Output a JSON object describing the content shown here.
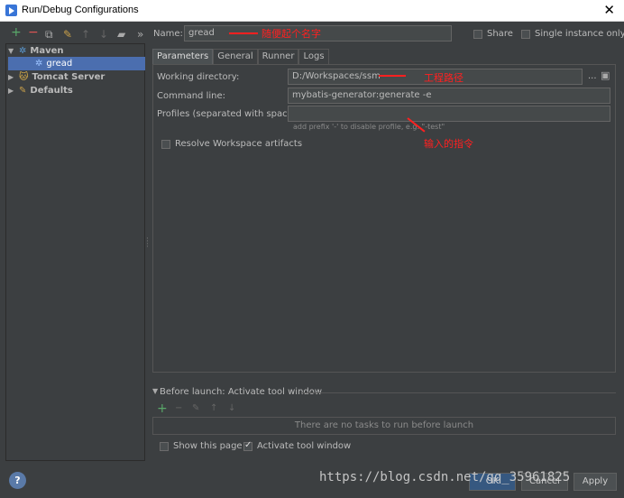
{
  "window": {
    "title": "Run/Debug Configurations"
  },
  "toolbar": {
    "add": "+",
    "remove": "−",
    "more": "»"
  },
  "tree": [
    {
      "label": "Maven",
      "expanded": true
    },
    {
      "label": "gread",
      "selected": true
    },
    {
      "label": "Tomcat Server",
      "expanded": false
    },
    {
      "label": "Defaults",
      "expanded": false
    }
  ],
  "name_row": {
    "label": "Name:",
    "value": "gread",
    "share": "Share",
    "single_instance": "Single instance only"
  },
  "tabs": [
    "Parameters",
    "General",
    "Runner",
    "Logs"
  ],
  "params": {
    "working_dir_label": "Working directory:",
    "working_dir_value": "D:/Workspaces/ssm",
    "browse_dots": "...",
    "command_label": "Command line:",
    "command_value": "mybatis-generator:generate -e",
    "profiles_label": "Profiles (separated with space):",
    "profiles_hint": "add prefix '-' to disable profile, e.g. \"-test\"",
    "resolve_label": "Resolve Workspace artifacts"
  },
  "annotations": {
    "name": "随便起个名字",
    "path": "工程路径",
    "command": "输入的指令"
  },
  "before_launch": {
    "title": "Before launch: Activate tool window",
    "empty_text": "There are no tasks to run before launch",
    "show_page": "Show this page",
    "activate": "Activate tool window"
  },
  "buttons": {
    "ok": "OK",
    "cancel": "Cancel",
    "apply": "Apply",
    "help": "?"
  },
  "watermark": "https://blog.csdn.net/qq_35961825",
  "colors": {
    "selection": "#4b6eaf",
    "annotation": "#ff2020",
    "background": "#3c3f41"
  }
}
